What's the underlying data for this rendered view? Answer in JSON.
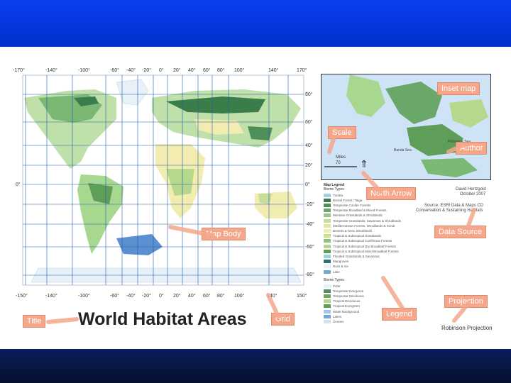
{
  "slide": {
    "title_text": "World Habitat Areas",
    "callouts": {
      "inset_map": "Inset map",
      "scale": "Scale",
      "author": "Author",
      "north_arrow": "North Arrow",
      "map_body": "Map Body",
      "data_source": "Data Source",
      "projection": "Projection",
      "title": "Title",
      "grid": "Grid",
      "legend": "Legend"
    },
    "top_ticks": [
      "-170°",
      "-140°",
      "-100°",
      "-60°",
      "-40°",
      "-20°",
      "0°",
      "20°",
      "40°",
      "60°",
      "80°",
      "100°",
      "140°",
      "170°"
    ],
    "bottom_ticks": [
      "-150°",
      "-140°",
      "-100°",
      "-60°",
      "-40°",
      "-20°",
      "0°",
      "20°",
      "40°",
      "60°",
      "80°",
      "100°",
      "140°",
      "150°"
    ],
    "lat_right": [
      "80°",
      "60°",
      "40°",
      "20°",
      "0°",
      "-20°",
      "-40°",
      "-60°",
      "-80°"
    ],
    "lat_left": "0°",
    "inset": {
      "scale_label": "Miles",
      "scale_value": "70",
      "sea_label_1": "Philippine Sea",
      "sea_label_2": "Banda Sea"
    },
    "author_block": [
      "David Hertzgold",
      "October 2007"
    ],
    "source_block": [
      "Source: ESRI Data & Maps CD",
      "Conservation & Sustaining Habitats"
    ],
    "projection_label": "Robinson Projection",
    "legend_title": "Map Legend",
    "legend_subtitle": "Biome Types",
    "legend_items": [
      {
        "label": "Tundra",
        "color": "#a8cfe0"
      },
      {
        "label": "Boreal Forest / Taiga",
        "color": "#3a7d4a"
      },
      {
        "label": "Temperate Conifer Forests",
        "color": "#4f8f5a"
      },
      {
        "label": "Temperate Broadleaf & Mixed Forests",
        "color": "#6aa86a"
      },
      {
        "label": "Montane Grasslands & Shrublands",
        "color": "#9fc28a"
      },
      {
        "label": "Temperate Grasslands, Savannas & Shrublands",
        "color": "#c7dd9a"
      },
      {
        "label": "Mediterranean Forests, Woodlands & Scrub",
        "color": "#e0e6a0"
      },
      {
        "label": "Deserts & Xeric Shrublands",
        "color": "#f2ecb0"
      },
      {
        "label": "Tropical & Subtropical Grasslands",
        "color": "#cfe08a"
      },
      {
        "label": "Tropical & Subtropical Coniferous Forests",
        "color": "#8ec07a"
      },
      {
        "label": "Tropical & Subtropical Dry Broadleaf Forests",
        "color": "#b6d88c"
      },
      {
        "label": "Tropical & Subtropical Moist Broadleaf Forests",
        "color": "#5f9e58"
      },
      {
        "label": "Flooded Grasslands & Savannas",
        "color": "#9dd0d8"
      },
      {
        "label": "Mangroves",
        "color": "#2f6f6a"
      },
      {
        "label": "Rock & Ice",
        "color": "#e8f0f8"
      },
      {
        "label": "Lake",
        "color": "#6ea8d8"
      }
    ],
    "legend2_title": "Biome Types",
    "legend2_items": [
      {
        "label": "Polar",
        "color": "#e8f0f8"
      },
      {
        "label": "Temperate Evergreen",
        "color": "#4f8f5a"
      },
      {
        "label": "Temperate Deciduous",
        "color": "#6aa86a"
      },
      {
        "label": "Tropical Deciduous",
        "color": "#b6d88c"
      },
      {
        "label": "Tropical Evergreen",
        "color": "#5f9e58"
      },
      {
        "label": "Water Background",
        "color": "#9dc8ea"
      },
      {
        "label": "Lakes",
        "color": "#6ea8d8"
      },
      {
        "label": "Oceans",
        "color": "#cfe3f6"
      }
    ]
  }
}
